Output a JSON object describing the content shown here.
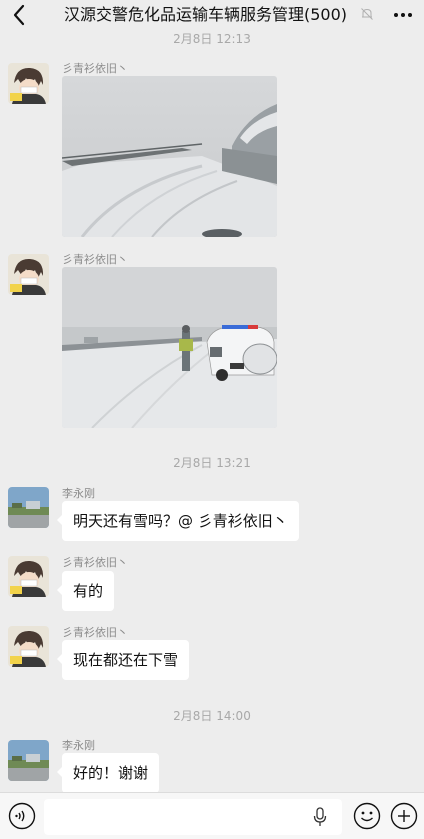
{
  "header": {
    "title": "汉源交警危化品运输车辆服务管理(500)"
  },
  "messages": {
    "ts1": "2月8日 12:13",
    "m1_sender": "彡青衫依旧丶",
    "m2_sender": "彡青衫依旧丶",
    "ts2": "2月8日 13:21",
    "m3_sender": "李永刚",
    "m3_text": "明天还有雪吗？@ 彡青衫依旧丶",
    "m4_sender": "彡青衫依旧丶",
    "m4_text": "有的",
    "m5_sender": "彡青衫依旧丶",
    "m5_text": "现在都还在下雪",
    "ts3": "2月8日 14:00",
    "m6_sender": "李永刚",
    "m6_text": "好的！谢谢"
  },
  "icons": {
    "back": "chevron-left-icon",
    "mute": "bell-mute-icon",
    "more": "more-dots-icon",
    "voice": "voice-icon",
    "mic": "microphone-icon",
    "emoji": "emoji-icon",
    "plus": "plus-icon"
  },
  "colors": {
    "background": "#ededed",
    "bubble": "#ffffff",
    "timestamp": "#a8a8a8"
  }
}
